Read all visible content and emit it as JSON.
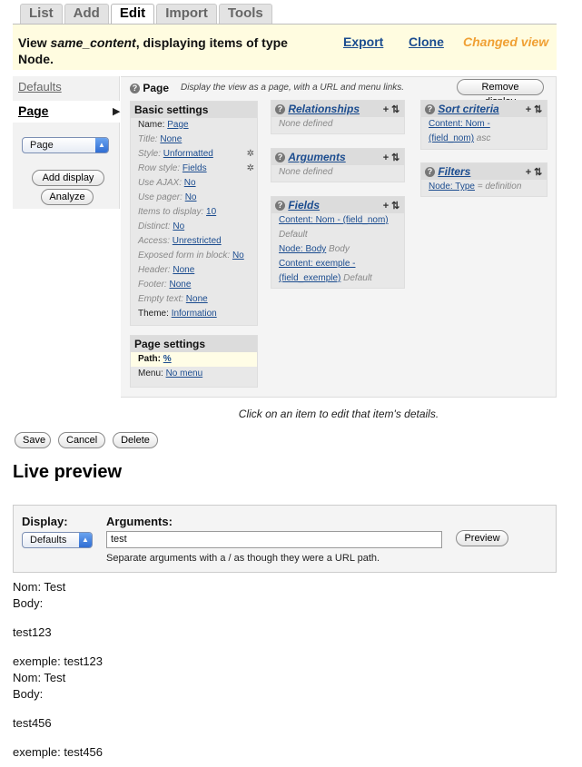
{
  "tabs": [
    "List",
    "Add",
    "Edit",
    "Import",
    "Tools"
  ],
  "active_tab": "Edit",
  "view": {
    "title_prefix": "View ",
    "view_name": "same_content",
    "title_suffix": ", displaying items of type",
    "title_line2": "Node.",
    "export": "Export",
    "clone": "Clone",
    "changed": "Changed view"
  },
  "left": {
    "defaults": "Defaults",
    "page": "Page",
    "arrow": "▶",
    "select_value": "Page",
    "add_display": "Add display",
    "analyze": "Analyze"
  },
  "page_panel": {
    "title": "Page",
    "description": "Display the view as a page, with a URL and menu links.",
    "remove_display": "Remove display",
    "basic": {
      "title": "Basic settings",
      "rows": [
        {
          "label": "Name:",
          "value": "Page",
          "plain": true
        },
        {
          "label": "Title:",
          "value": "None"
        },
        {
          "label": "Style:",
          "value": "Unformatted",
          "gear": true
        },
        {
          "label": "Row style:",
          "value": "Fields",
          "gear": true
        },
        {
          "label": "Use AJAX:",
          "value": "No"
        },
        {
          "label": "Use pager:",
          "value": "No"
        },
        {
          "label": "Items to display:",
          "value": "10"
        },
        {
          "label": "Distinct:",
          "value": "No"
        },
        {
          "label": "Access:",
          "value": "Unrestricted"
        },
        {
          "label": "Exposed form in block:",
          "value": "No"
        },
        {
          "label": "Header:",
          "value": "None"
        },
        {
          "label": "Footer:",
          "value": "None"
        },
        {
          "label": "Empty text:",
          "value": "None"
        },
        {
          "label": "Theme:",
          "value": "Information",
          "plain": true
        }
      ]
    },
    "page_settings": {
      "title": "Page settings",
      "path_label": "Path:",
      "path_value": "%",
      "menu_label": "Menu:",
      "menu_value": "No menu"
    },
    "relationships": {
      "title": "Relationships",
      "empty": "None defined"
    },
    "arguments": {
      "title": "Arguments",
      "empty": "None defined"
    },
    "fields": {
      "title": "Fields",
      "items": [
        {
          "link": "Content: Nom - (field_nom)",
          "suffix": "",
          "line2": "Default"
        },
        {
          "link": "Node: Body",
          "suffix": " Body",
          "line2": ""
        },
        {
          "link": "Content: exemple -",
          "suffix": "",
          "line2": ""
        },
        {
          "link": "(field_exemple)",
          "suffix": " Default",
          "line2": ""
        }
      ]
    },
    "sort": {
      "title": "Sort criteria",
      "link1": "Content: Nom -",
      "link2": "(field_nom)",
      "suffix": " asc"
    },
    "filters": {
      "title": "Filters",
      "link": "Node: Type",
      "suffix": " = definition"
    },
    "footnote": "Click on an item to edit that item's details."
  },
  "actions": {
    "save": "Save",
    "cancel": "Cancel",
    "delete": "Delete"
  },
  "live_preview": {
    "title": "Live preview",
    "display_label": "Display:",
    "display_value": "Defaults",
    "arguments_label": "Arguments:",
    "arguments_value": "test",
    "preview_button": "Preview",
    "help": "Separate arguments with a / as though they were a URL path."
  },
  "output_lines": [
    "Nom: Test",
    "Body:",
    "test123",
    "exemple: test123",
    "Nom: Test",
    "Body:",
    "test456",
    "exemple: test456"
  ],
  "icon_names": [
    "help-icon",
    "gear-icon",
    "add-icon",
    "rearrange-icon",
    "select-arrow-icon"
  ]
}
